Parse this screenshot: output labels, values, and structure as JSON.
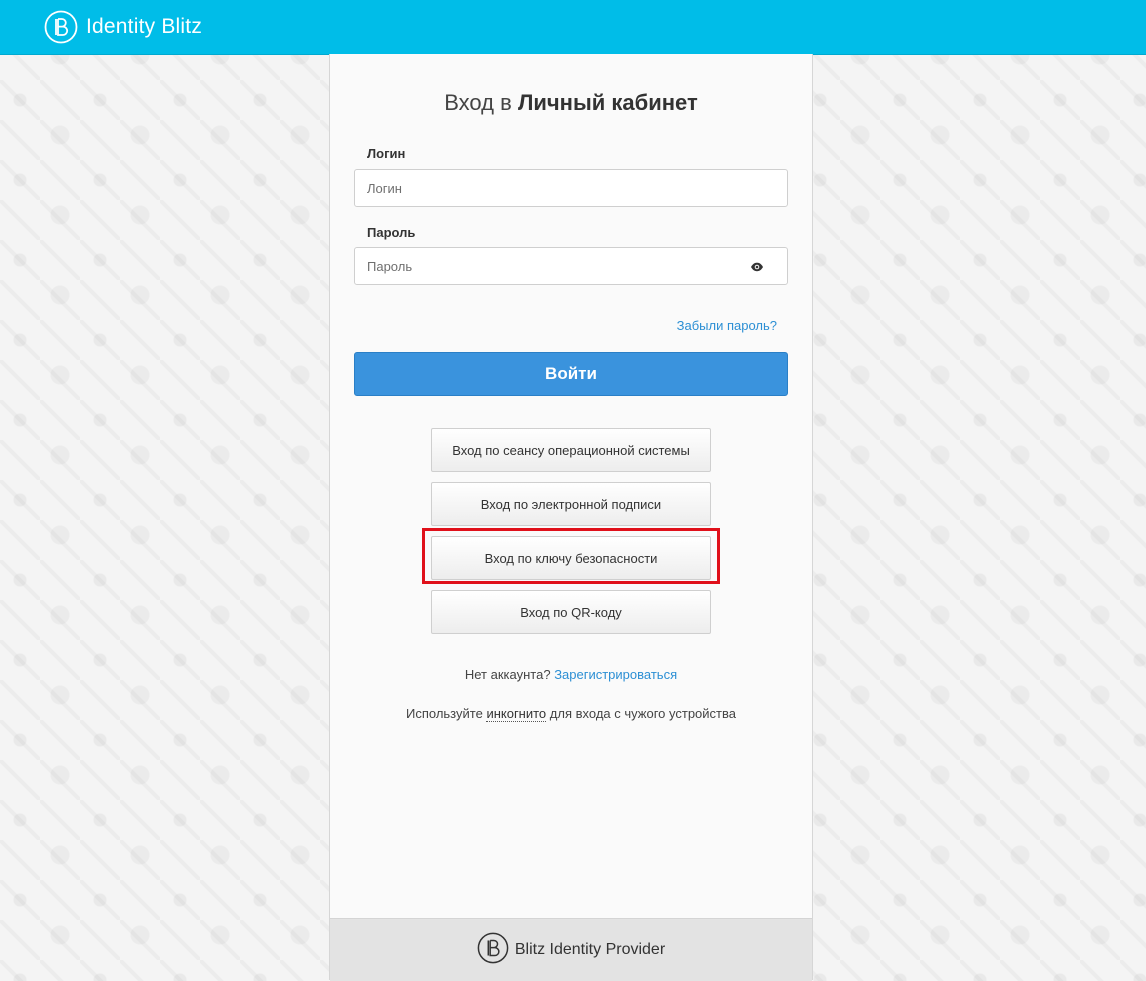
{
  "header": {
    "brand_name": "Identity Blitz",
    "background_color": "#00bde8",
    "logo_icon": "blitz-b-logo"
  },
  "login": {
    "title_prefix": "Вход в",
    "title_strong": "Личный кабинет",
    "username_label": "Логин",
    "username_placeholder": "Логин",
    "username_value": "",
    "password_label": "Пароль",
    "password_placeholder": "Пароль",
    "password_value": "",
    "password_toggle_icon": "eye-icon",
    "forgot_password": "Забыли пароль?",
    "submit_label": "Войти",
    "submit_color": "#3a93dd"
  },
  "alt_methods": [
    {
      "label": "Вход по сеансу операционной системы"
    },
    {
      "label": "Вход по электронной подписи"
    },
    {
      "label": "Вход по ключу безопасности",
      "highlighted": true
    },
    {
      "label": "Вход по QR-коду"
    }
  ],
  "highlight_color": "#e0101a",
  "register": {
    "prompt": "Нет аккаунта?",
    "link": "Зарегистрироваться"
  },
  "incognito": {
    "prefix": "Используйте",
    "link": "инкогнито",
    "suffix": "для входа с чужого устройства"
  },
  "footer": {
    "product_name": "Blitz Identity Provider",
    "logo_icon": "blitz-b-logo"
  }
}
